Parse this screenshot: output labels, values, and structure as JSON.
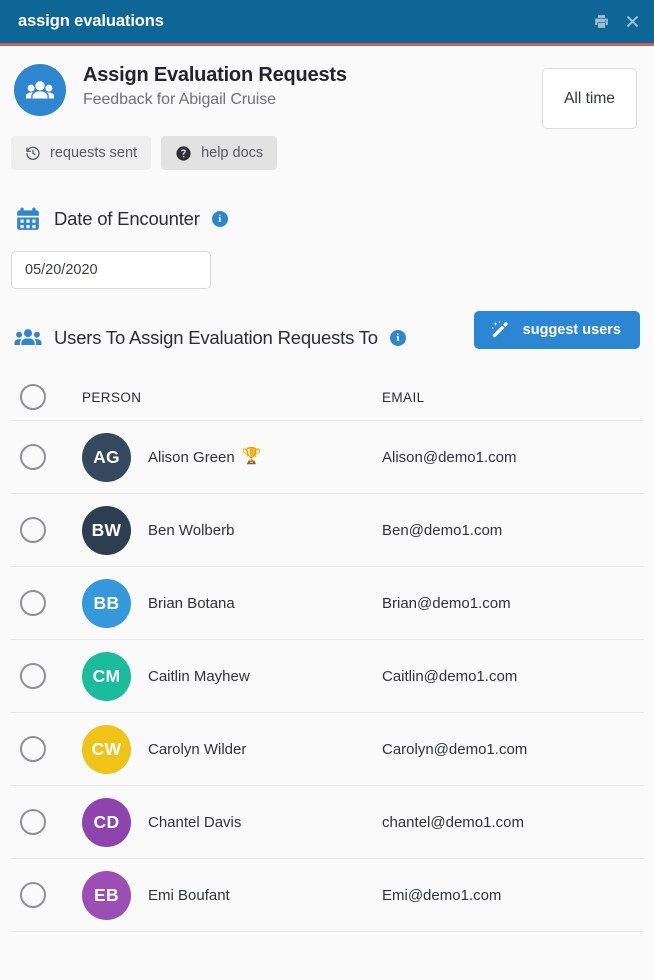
{
  "titlebar": {
    "title": "assign evaluations",
    "print_icon": "printer-icon",
    "close_icon": "close-icon",
    "background": "#0d6696",
    "accent_color": "#cf5b55"
  },
  "header": {
    "icon": "group-people-icon",
    "title": "Assign Evaluation Requests",
    "subtitle": "Feedback for Abigail Cruise",
    "time_filter_label": "All time"
  },
  "pills": [
    {
      "label": "requests sent",
      "icon": "history-clock-icon"
    },
    {
      "label": "help docs",
      "icon": "question-circle-icon"
    }
  ],
  "date_section": {
    "icon": "calendar-icon",
    "label": "Date of Encounter",
    "info_icon": "info-icon",
    "info_glyph": "i",
    "value": "05/20/2020",
    "placeholder": "mm/dd/yyyy"
  },
  "users_section": {
    "icon": "group-people-icon",
    "label": "Users To Assign Evaluation Requests To",
    "info_icon": "info-icon",
    "info_glyph": "i",
    "suggest_label": "suggest users",
    "suggest_icon": "magic-wand-icon",
    "suggest_color": "#2b87d3"
  },
  "table": {
    "columns": {
      "person": "PERSON",
      "email": "EMAIL"
    },
    "rows": [
      {
        "initials": "AG",
        "name": "Alison Green",
        "badge": "🏆",
        "email": "Alison@demo1.com",
        "color": "#34495e"
      },
      {
        "initials": "BW",
        "name": "Ben Wolberb",
        "badge": "",
        "email": "Ben@demo1.com",
        "color": "#2c3e50"
      },
      {
        "initials": "BB",
        "name": "Brian Botana",
        "badge": "",
        "email": "Brian@demo1.com",
        "color": "#3498db"
      },
      {
        "initials": "CM",
        "name": "Caitlin Mayhew",
        "badge": "",
        "email": "Caitlin@demo1.com",
        "color": "#1abc9c"
      },
      {
        "initials": "CW",
        "name": "Carolyn Wilder",
        "badge": "",
        "email": "Carolyn@demo1.com",
        "color": "#f0c319"
      },
      {
        "initials": "CD",
        "name": "Chantel Davis",
        "badge": "",
        "email": "chantel@demo1.com",
        "color": "#8e44ad"
      },
      {
        "initials": "EB",
        "name": "Emi Boufant",
        "badge": "",
        "email": "Emi@demo1.com",
        "color": "#9b4fb5"
      }
    ]
  }
}
